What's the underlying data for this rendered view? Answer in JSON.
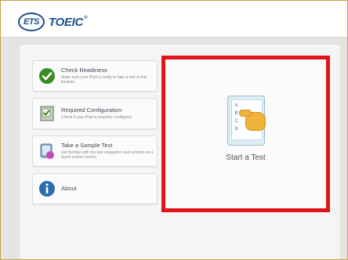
{
  "header": {
    "ets_logo_text": "ETS",
    "brand": "TOEIC",
    "trademark": "®"
  },
  "menu": {
    "items": [
      {
        "title": "Check Readiness",
        "desc": "Make sure your iPad is ready to take a test at this location."
      },
      {
        "title": "Required Configuration",
        "desc": "Check if your iPad is properly configured."
      },
      {
        "title": "Take a Sample Test",
        "desc": "Get familiar with the test navigation and controls on a touch-screen device."
      },
      {
        "title": "About",
        "desc": ""
      }
    ]
  },
  "start_test": {
    "label": "Start a Test",
    "options": [
      "A",
      "B",
      "C",
      "D"
    ]
  },
  "colors": {
    "accent_red": "#e0141c",
    "brand_blue": "#1b4f8f",
    "check_green": "#3c8c22"
  },
  "icons": [
    "checkmark-icon",
    "configuration-icon",
    "sample-test-icon",
    "info-icon",
    "tablet-hand-icon"
  ]
}
